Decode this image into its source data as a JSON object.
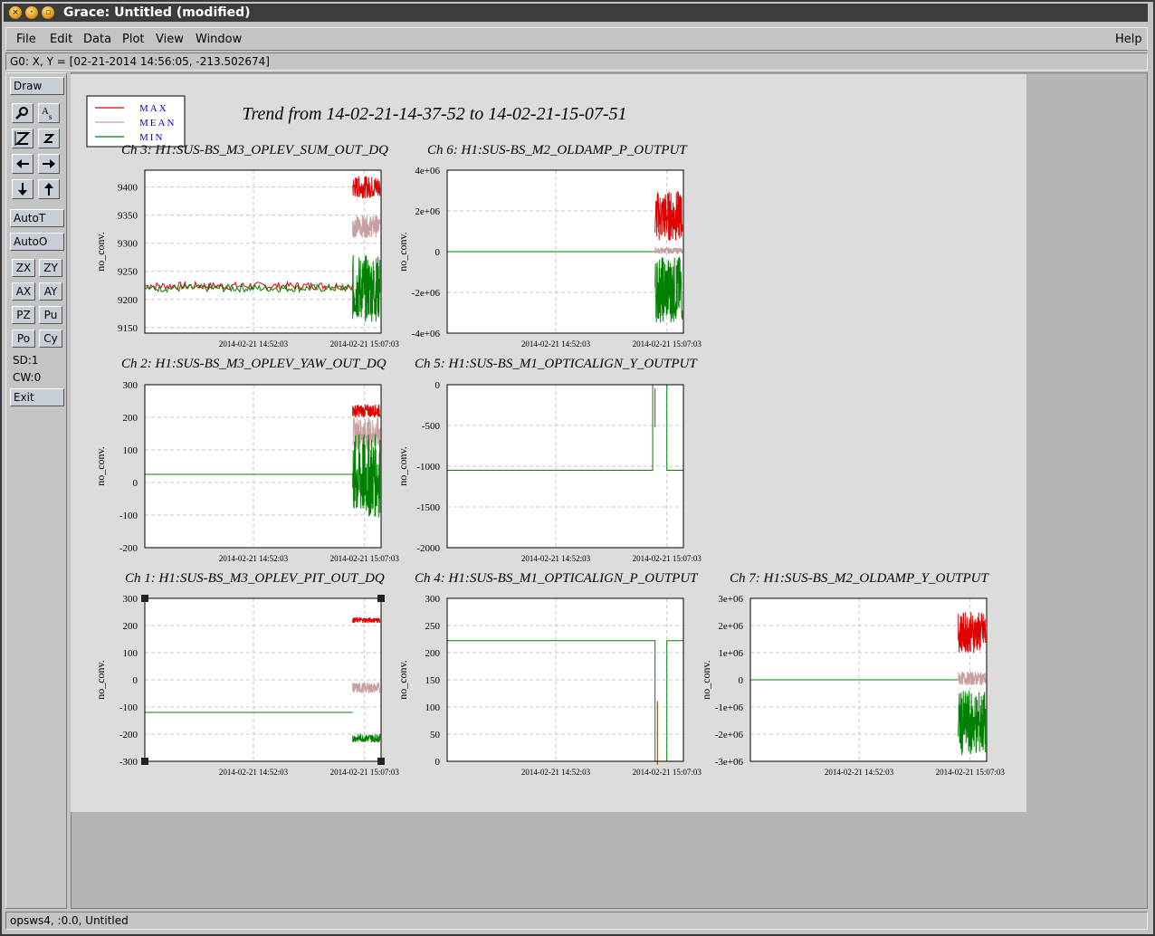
{
  "window": {
    "title": "Grace: Untitled (modified)"
  },
  "menu": {
    "file": "File",
    "edit": "Edit",
    "data": "Data",
    "plot": "Plot",
    "view": "View",
    "window": "Window",
    "help": "Help"
  },
  "coords": "G0: X, Y = [02-21-2014 14:56:05, -213.502674]",
  "toolbar": {
    "draw": "Draw",
    "autot": "AutoT",
    "autoo": "AutoO",
    "zx": "ZX",
    "zy": "ZY",
    "ax": "AX",
    "ay": "AY",
    "pz": "PZ",
    "pu": "Pu",
    "po": "Po",
    "cy": "Cy",
    "sd": "SD:1",
    "cw": "CW:0",
    "exit": "Exit",
    "icons": [
      "zoom-icon",
      "text-icon",
      "autoscale-z-icon",
      "small-z-icon",
      "arrow-left-icon",
      "arrow-right-icon",
      "arrow-down-icon",
      "arrow-up-icon"
    ]
  },
  "status": "opsws4, :0.0, Untitled",
  "chart_data": {
    "title": "Trend from 14-02-21-14-37-52 to 14-02-21-15-07-51",
    "legend": [
      {
        "label": "MAX",
        "color": "#e00000"
      },
      {
        "label": "MEAN",
        "color": "#c8a0a0"
      },
      {
        "label": "MIN",
        "color": "#008000"
      }
    ],
    "legend_position": "top-left",
    "x_ticks": [
      "2014-02-21 14:52:03",
      "2014-02-21 15:07:03"
    ],
    "ylabel": "no_conv.",
    "grid": true,
    "panels": [
      {
        "title": "Ch 3: H1:SUS-BS_M3_OPLEV_SUM_OUT_DQ",
        "type": "line",
        "ylim": [
          9140,
          9430
        ],
        "yticks": [
          "9400",
          "9350",
          "9300",
          "9250",
          "9200",
          "9150"
        ],
        "flat": 9220,
        "burst": {
          "max": [
            9380,
            9420
          ],
          "mean": [
            9310,
            9350
          ],
          "min": [
            9160,
            9280
          ]
        }
      },
      {
        "title": "Ch 6: H1:SUS-BS_M2_OLDAMP_P_OUTPUT",
        "type": "line",
        "ylim": [
          -4000000,
          4000000
        ],
        "yticks": [
          "4e+06",
          "2e+06",
          "0",
          "-2e+06",
          "-4e+06"
        ],
        "flat": 0,
        "burst": {
          "max": [
            500000,
            3000000
          ],
          "mean": [
            -100000,
            200000
          ],
          "min": [
            -3500000,
            -200000
          ]
        }
      },
      {
        "title": "Ch 2: H1:SUS-BS_M3_OPLEV_YAW_OUT_DQ",
        "type": "line",
        "ylim": [
          -200,
          300
        ],
        "yticks": [
          "300",
          "200",
          "100",
          "0",
          "-100",
          "-200"
        ],
        "flat": 25,
        "burst": {
          "max": [
            200,
            240
          ],
          "mean": [
            100,
            200
          ],
          "min": [
            -110,
            150
          ]
        }
      },
      {
        "title": "Ch 5: H1:SUS-BS_M1_OPTICALIGN_Y_OUTPUT",
        "type": "line",
        "ylim": [
          -2000,
          0
        ],
        "yticks": [
          "0",
          "-500",
          "-1000",
          "-1500",
          "-2000"
        ],
        "flat": -1050,
        "step": [
          {
            "at": 0.87,
            "value": 0
          },
          {
            "at": 0.93,
            "value": -1050
          }
        ]
      },
      {
        "title": "Ch 1: H1:SUS-BS_M3_OPLEV_PIT_OUT_DQ",
        "type": "line",
        "ylim": [
          -300,
          300
        ],
        "yticks": [
          "300",
          "200",
          "100",
          "0",
          "-100",
          "-200",
          "-300"
        ],
        "flat": -120,
        "burst": {
          "max": [
            210,
            230
          ],
          "mean": [
            -50,
            -10
          ],
          "min": [
            -230,
            -200
          ]
        }
      },
      {
        "title": "Ch 4: H1:SUS-BS_M1_OPTICALIGN_P_OUTPUT",
        "type": "line",
        "ylim": [
          0,
          300
        ],
        "yticks": [
          "300",
          "250",
          "200",
          "150",
          "100",
          "50",
          "0"
        ],
        "flat": 222,
        "step": [
          {
            "at": 0.88,
            "value": 0
          },
          {
            "at": 0.93,
            "value": 222
          }
        ]
      },
      {
        "title": "Ch 7: H1:SUS-BS_M2_OLDAMP_Y_OUTPUT",
        "type": "line",
        "ylim": [
          -3000000,
          3000000
        ],
        "yticks": [
          "3e+06",
          "2e+06",
          "1e+06",
          "0",
          "-1e+06",
          "-2e+06",
          "-3e+06"
        ],
        "flat": 0,
        "burst": {
          "max": [
            1000000,
            2500000
          ],
          "mean": [
            -200000,
            300000
          ],
          "min": [
            -2800000,
            -400000
          ]
        }
      }
    ]
  }
}
